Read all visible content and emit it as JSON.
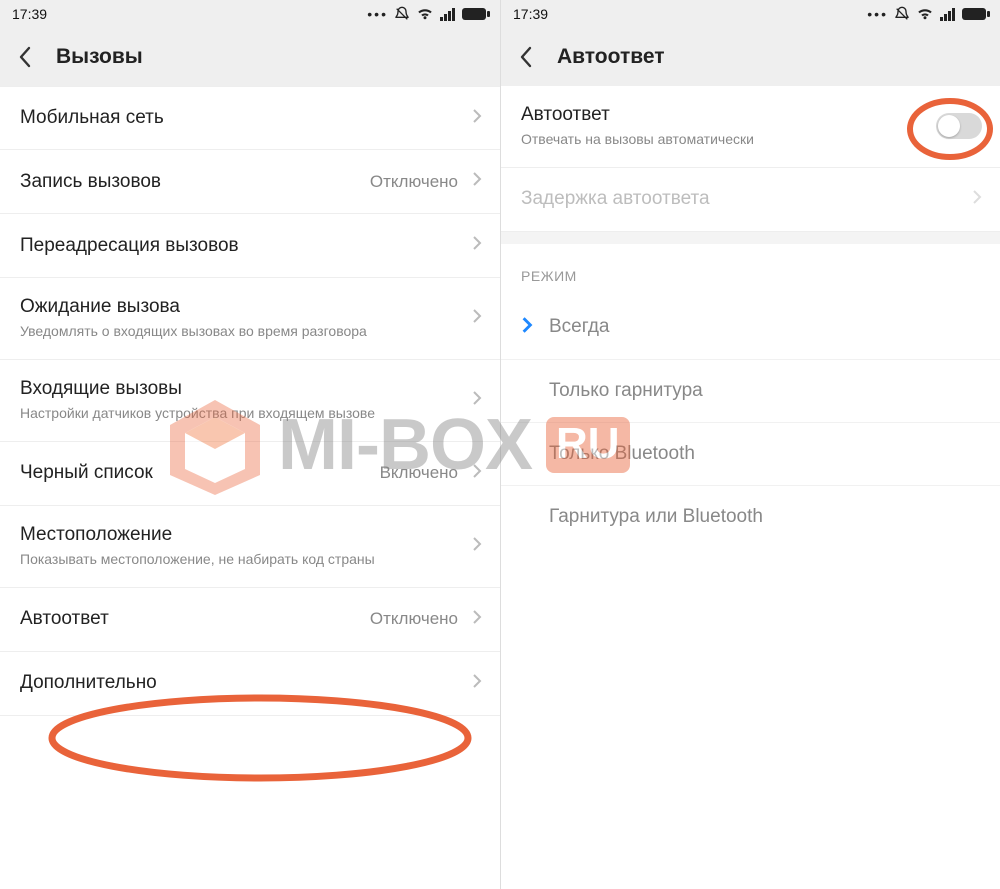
{
  "statusbar": {
    "time": "17:39"
  },
  "left": {
    "title": "Вызовы",
    "items": [
      {
        "label": "Мобильная сеть",
        "sub": "",
        "value": ""
      },
      {
        "label": "Запись вызовов",
        "sub": "",
        "value": "Отключено"
      },
      {
        "label": "Переадресация вызовов",
        "sub": "",
        "value": ""
      },
      {
        "label": "Ожидание вызова",
        "sub": "Уведомлять о входящих вызовах во время разговора",
        "value": ""
      },
      {
        "label": "Входящие вызовы",
        "sub": "Настройки датчиков устройства при входящем вызове",
        "value": ""
      },
      {
        "label": "Черный список",
        "sub": "",
        "value": "Включено"
      },
      {
        "label": "Местоположение",
        "sub": "Показывать местоположение, не набирать код страны",
        "value": ""
      },
      {
        "label": "Автоответ",
        "sub": "",
        "value": "Отключено"
      },
      {
        "label": "Дополнительно",
        "sub": "",
        "value": ""
      }
    ]
  },
  "right": {
    "title": "Автоответ",
    "toggle": {
      "label": "Автоответ",
      "sub": "Отвечать на вызовы автоматически",
      "on": false
    },
    "delay": {
      "label": "Задержка автоответа"
    },
    "section": "РЕЖИМ",
    "modes": [
      {
        "label": "Всегда",
        "selected": true
      },
      {
        "label": "Только гарнитура",
        "selected": false
      },
      {
        "label": "Только Bluetooth",
        "selected": false
      },
      {
        "label": "Гарнитура или Bluetooth",
        "selected": false
      }
    ]
  },
  "watermark": {
    "text": "MI-BOX",
    "suffix": "RU"
  },
  "colors": {
    "highlight": "#e9633a",
    "link": "#1e88ff"
  }
}
